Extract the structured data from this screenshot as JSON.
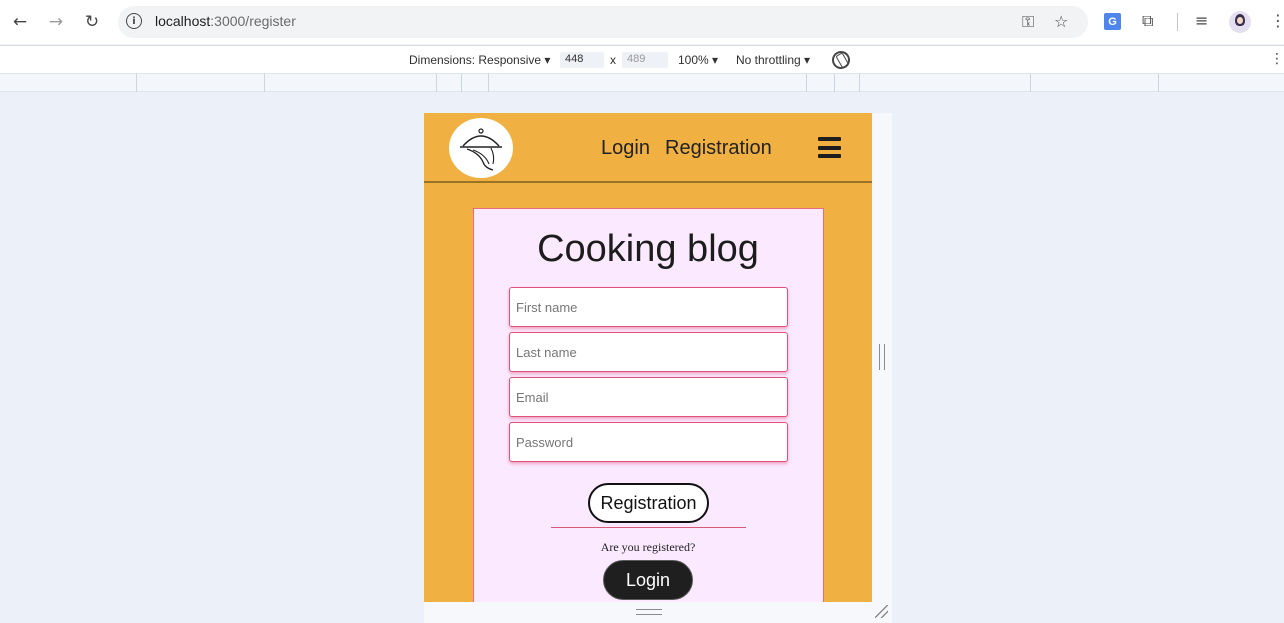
{
  "browser": {
    "url_host": "localhost",
    "url_path": ":3000/register"
  },
  "devtools": {
    "dimensions_label": "Dimensions: Responsive",
    "width": "448",
    "times": "x",
    "height": "489",
    "zoom": "100%",
    "throttling": "No throttling"
  },
  "site": {
    "nav": {
      "login": "Login",
      "registration": "Registration"
    },
    "card": {
      "title": "Cooking blog",
      "fields": {
        "first_name_placeholder": "First name",
        "last_name_placeholder": "Last name",
        "email_placeholder": "Email",
        "password_placeholder": "Password"
      },
      "registration_button": "Registration",
      "question": "Are you registered?",
      "login_button": "Login"
    }
  },
  "colors": {
    "header_bg": "#f0b142",
    "card_bg": "#fbeaff",
    "card_border": "#e36f7e",
    "field_border": "#e0527a"
  }
}
